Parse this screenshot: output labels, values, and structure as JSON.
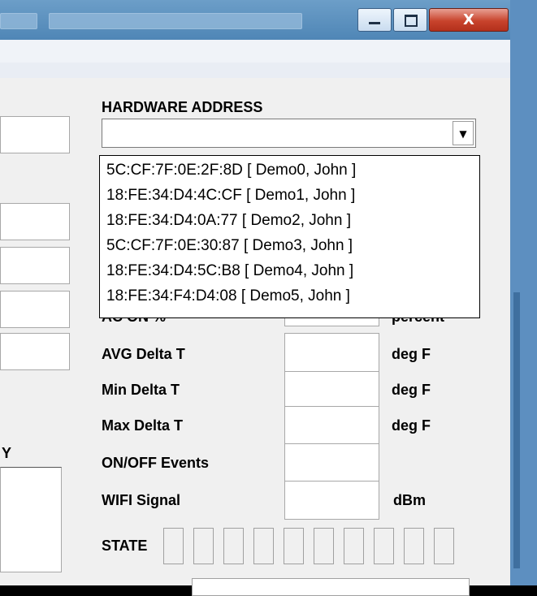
{
  "window": {
    "title_blurred": "",
    "buttons": {
      "minimize": "–",
      "maximize": "□",
      "close": "X"
    }
  },
  "hardware": {
    "label": "HARDWARE ADDRESS",
    "selected_value": "",
    "options": [
      "5C:CF:7F:0E:2F:8D [ Demo0, John ]",
      "18:FE:34:D4:4C:CF [ Demo1, John ]",
      "18:FE:34:D4:0A:77 [ Demo2, John ]",
      "5C:CF:7F:0E:30:87 [ Demo3, John ]",
      "18:FE:34:D4:5C:B8 [ Demo4, John ]",
      "18:FE:34:F4:D4:08 [ Demo5, John ]"
    ]
  },
  "metrics": [
    {
      "label": "AC ON %",
      "unit": "percent"
    },
    {
      "label": "AVG Delta T",
      "unit": "deg F"
    },
    {
      "label": "Min Delta T",
      "unit": "deg F"
    },
    {
      "label": "Max Delta T",
      "unit": "deg F"
    },
    {
      "label": "ON/OFF Events",
      "unit": ""
    },
    {
      "label": "WIFI Signal",
      "unit": "dBm"
    }
  ],
  "state": {
    "label": "STATE",
    "cells": 10
  },
  "left_partial": {
    "label_fragment": "Y"
  },
  "icons": {
    "dropdown_arrow": "chevron-down-icon"
  }
}
